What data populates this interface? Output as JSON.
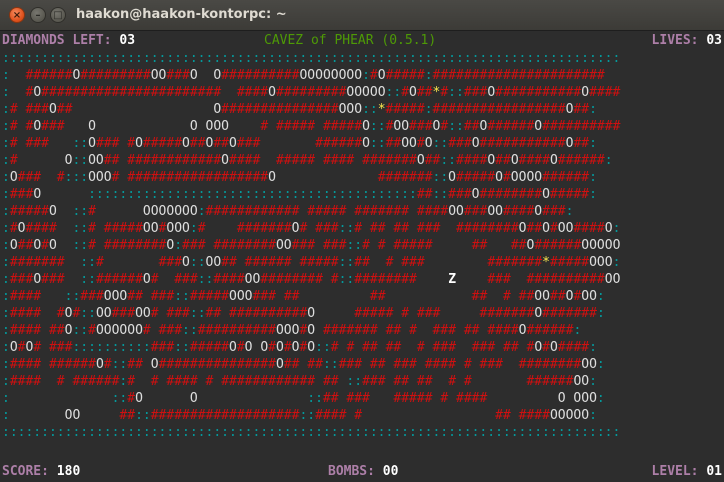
{
  "window": {
    "title": "haakon@haakon-kontorpc: ~",
    "close_glyph": "×",
    "min_glyph": "–",
    "max_glyph": "□"
  },
  "header": {
    "diamonds_label": "DIAMONDS LEFT:",
    "diamonds_value": "03",
    "game_title": "CAVEZ of PHEAR (0.5.1)",
    "lives_label": "LIVES:",
    "lives_value": "03"
  },
  "footer": {
    "score_label": "SCORE:",
    "score_value": "180",
    "bombs_label": "BOMBS:",
    "bombs_value": "00",
    "level_label": "LEVEL:",
    "level_value": "01"
  },
  "colors": {
    "dirt": "#d01010",
    "wall": "#05989a",
    "boulder": "#dedede",
    "diamond": "#fce94f",
    "player": "#ffffff",
    "label": "#ad7fa8",
    "title": "#4e9a06"
  },
  "legend": {
    "dirt": "#",
    "wall": ":",
    "boulder": "O",
    "diamond": "*",
    "player": "Z"
  },
  "map": [
    "::::::::::::::::::::::::::::::::::::::::::::::::::::::::::::::::::::::::::::::::::::::::::::::::::::::::::",
    ":  ######O#########OO###O  O##########OOOOOOOO:#O#####:######################",
    ":  #O#######################  ####O#########OOOOO::#O##*#::###O###########O#####:",
    ":# ###O##                  O###############OOO::*#####:#################O##:",
    ":# #O###   O            O OOO    # ##### #####O::#OO###O#::##O######O##########O##:",
    ":# ###   ::O### #O#####O##O##O###       ######O::##OO#O::###O###########O##:",
    ":#      O::OO## ############O####  ##### #### #######O##::####O##O####O######:",
    ":O###  #:::OOO# ##################O             #######::O#####O#OOOO######:",
    ":###O      ::::::::::::::::::::::::::::::::::::::::::##::###O########O#####:",
    ":#####O  ::#      OOOOOOO:############ ##### ####### ####OO###OO####O###:",
    ":#O####  ::# #####OO#OOO:#    #######O# ###::# ## ## ###  ########O##O#OO####O:",
    ":O##O#O  ::# ########O:### ########OO### ###::# # #####     ##   ##O######OOOOOO:",
    ":#######  ::#       ###O::OO## ###### #####::##  # ###        #######*#####OOO:",
    ":###O###  ::######O#  ###::####OO######## #::########    Z    ###  ##########OOO:",
    ":####   ::###OOO## ###::#####OOO### ##         ##           ##  # ##OO##O#OO:",
    ":####  #O#::OO###OO# ###::## ##########O     ##### # ###     #######O#######:",
    ":#### ##O::#OOOOOO# ###::##########OOO#O ####### ## #  ### ## ####O######:",
    ":O#O# ###::::::::::###::#####O#O O#O#O#O::# # ## ##  # ###  ### ## #O#O####:",
    ":#### ######O#::## O###############O## ##::### ## ### #### # ###  ########OO:",
    ":####  # ######:#  # #### # ############ ## ::### ## ##  # #       ######OO:",
    ":             ::#O      O              ::## ###   ##### # ####         O OOO:",
    ":       OO     ##::###################::#### #                 ## ####OOOOO:",
    "::::::::::::::::::::::::::::::::::::::::::::::::::::::::::::::::::::::::::::::::::::::::::::::::::::::::::"
  ]
}
